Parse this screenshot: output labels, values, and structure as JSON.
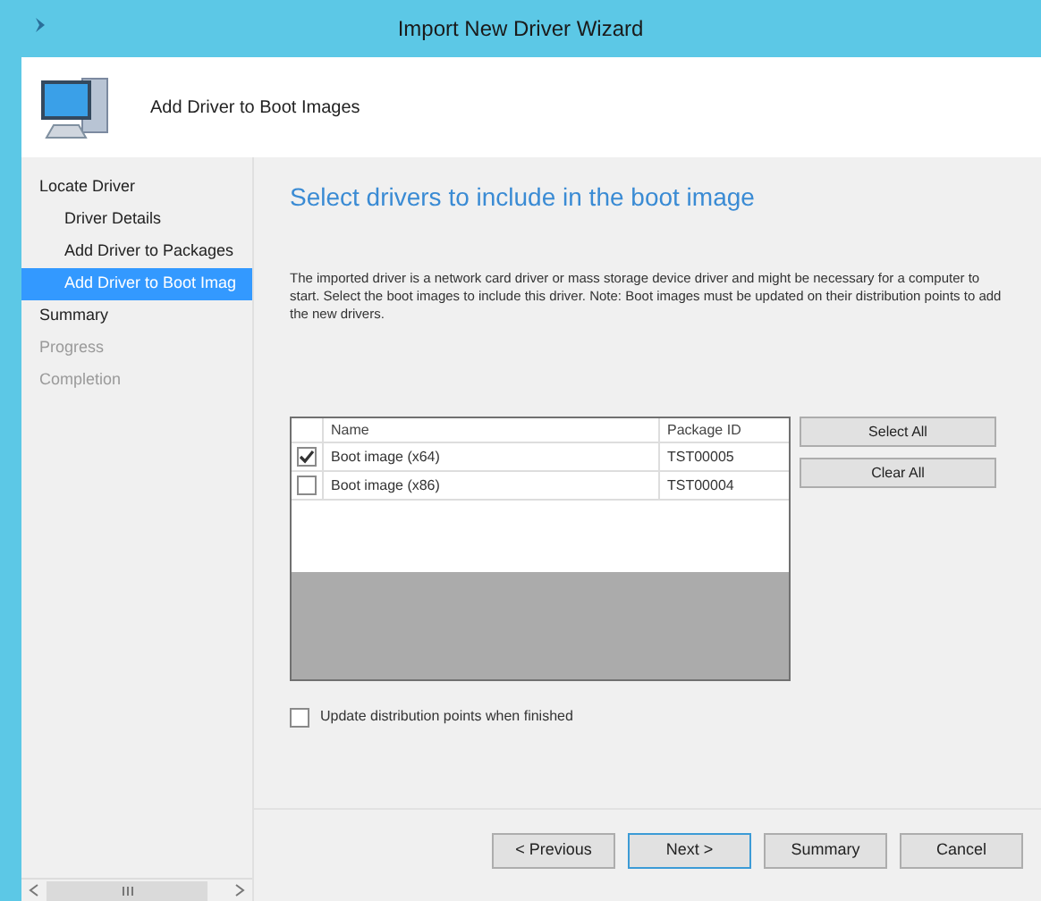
{
  "window": {
    "title": "Import New Driver Wizard"
  },
  "header": {
    "title": "Add Driver to Boot Images"
  },
  "nav": {
    "items": [
      {
        "label": "Locate Driver",
        "selected": false,
        "disabled": false,
        "children": [
          {
            "label": "Driver Details",
            "selected": false,
            "disabled": false
          },
          {
            "label": "Add Driver to Packages",
            "selected": false,
            "disabled": false
          },
          {
            "label": "Add Driver to Boot Imag",
            "selected": true,
            "disabled": false
          }
        ]
      },
      {
        "label": "Summary",
        "selected": false,
        "disabled": false
      },
      {
        "label": "Progress",
        "selected": false,
        "disabled": true
      },
      {
        "label": "Completion",
        "selected": false,
        "disabled": true
      }
    ]
  },
  "page": {
    "heading": "Select drivers to include in the boot image",
    "description": "The imported driver is a network card driver or mass storage device driver and might be necessary for a computer to start. Select the boot images to include this driver.  Note: Boot images must be updated on their distribution points to add the new drivers.",
    "table": {
      "columns": [
        "Name",
        "Package ID"
      ],
      "rows": [
        {
          "name": "Boot image (x64)",
          "package_id": "TST00005",
          "checked": true
        },
        {
          "name": "Boot image (x86)",
          "package_id": "TST00004",
          "checked": false
        }
      ]
    },
    "side_buttons": [
      "Select All",
      "Clear All"
    ],
    "update_checkbox": {
      "label": "Update distribution points when finished",
      "checked": false
    }
  },
  "footer_buttons": [
    {
      "label": "< Previous",
      "default": false
    },
    {
      "label": "Next >",
      "default": true
    },
    {
      "label": "Summary",
      "default": false
    },
    {
      "label": "Cancel",
      "default": false
    }
  ]
}
